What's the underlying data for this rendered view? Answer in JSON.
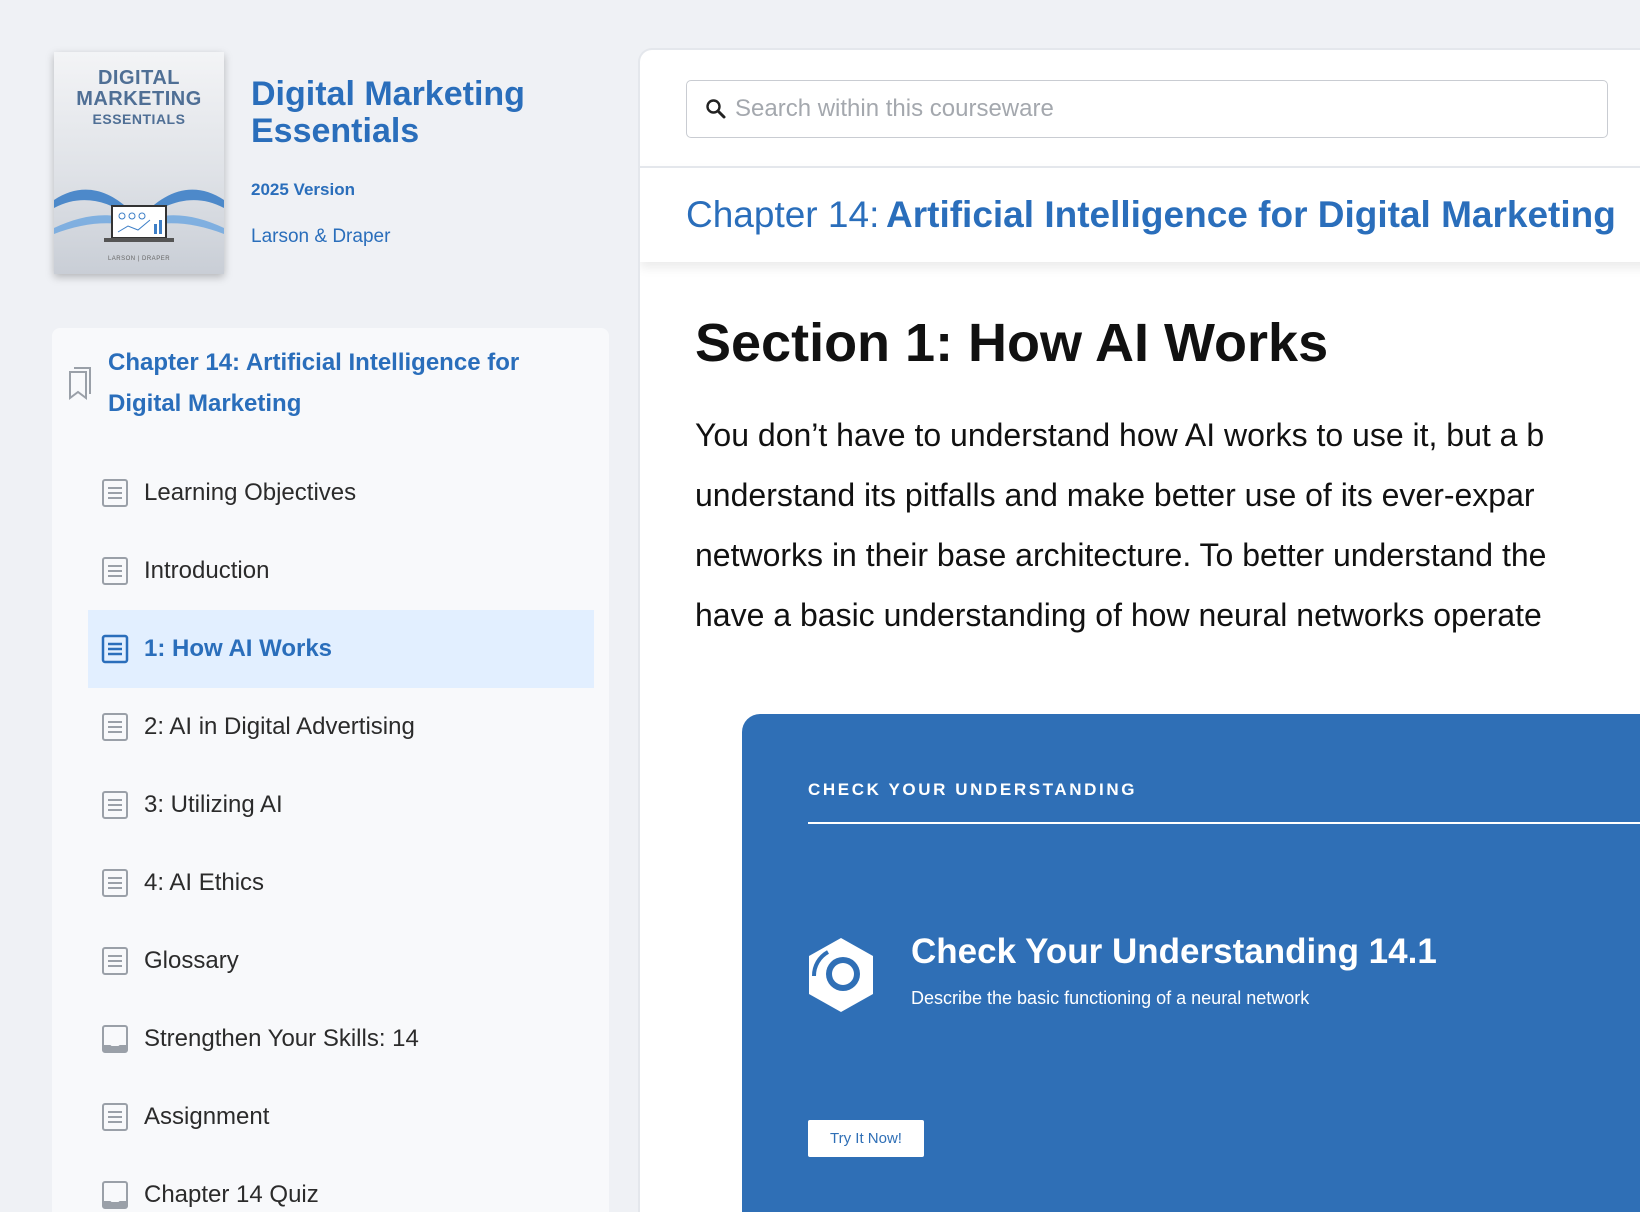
{
  "book": {
    "cover": {
      "title_line1": "DIGITAL",
      "title_line2": "MARKETING",
      "title_line3": "ESSENTIALS",
      "authors": "LARSON | DRAPER"
    },
    "title": "Digital Marketing Essentials",
    "version": "2025 Version",
    "authors": "Larson & Draper"
  },
  "toc": {
    "chapter": "Chapter 14: Artificial Intelligence for Digital Marketing",
    "items": [
      {
        "label": "Learning Objectives",
        "icon": "document-icon"
      },
      {
        "label": "Introduction",
        "icon": "document-icon"
      },
      {
        "label": "1: How AI Works",
        "icon": "document-icon",
        "active": true
      },
      {
        "label": "2: AI in Digital Advertising",
        "icon": "document-icon"
      },
      {
        "label": "3: Utilizing AI",
        "icon": "document-icon"
      },
      {
        "label": "4: AI Ethics",
        "icon": "document-icon"
      },
      {
        "label": "Glossary",
        "icon": "document-icon"
      },
      {
        "label": "Strengthen Your Skills: 14",
        "icon": "assessment-icon"
      },
      {
        "label": "Assignment",
        "icon": "document-icon"
      },
      {
        "label": "Chapter 14 Quiz",
        "icon": "assessment-icon"
      }
    ]
  },
  "search": {
    "placeholder": "Search within this courseware",
    "value": ""
  },
  "main": {
    "chapter_prefix": "Chapter 14:",
    "chapter_name": "Artificial Intelligence for Digital Marketing",
    "section_title": "Section 1: How AI Works",
    "paragraph_lines": [
      "You don’t have to understand how AI works to use it, but a b",
      "understand its pitfalls and make better use of its ever-expar",
      "networks in their base architecture. To better understand the",
      "have a basic understanding of how neural networks operate"
    ]
  },
  "cyu": {
    "header": "CHECK YOUR UNDERSTANDING",
    "title": "Check Your Understanding 14.1",
    "description": "Describe the basic functioning of a neural network",
    "button_label": "Try It Now!"
  },
  "colors": {
    "accent": "#2a6ebb",
    "card_bg": "#2f6fb6",
    "active_item_bg": "#e2efff",
    "page_bg": "#eff1f5"
  }
}
